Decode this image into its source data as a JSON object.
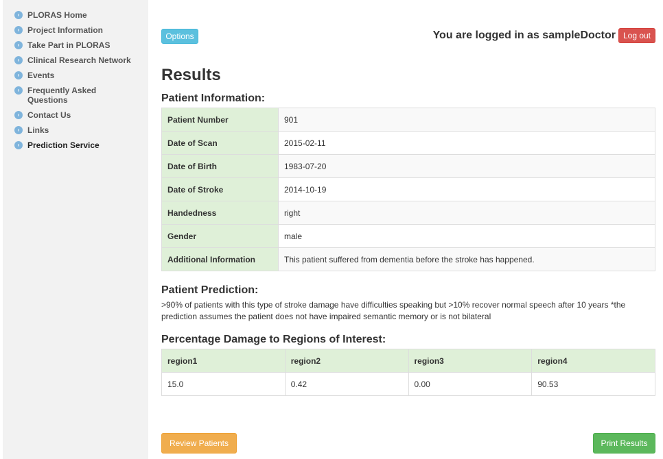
{
  "sidebar": {
    "items": [
      {
        "label": "PLORAS Home",
        "icon": "chevron-right-icon"
      },
      {
        "label": "Project Information",
        "icon": "chevron-right-icon"
      },
      {
        "label": "Take Part in PLORAS",
        "icon": "chevron-right-icon"
      },
      {
        "label": "Clinical Research Network",
        "icon": "chevron-right-icon"
      },
      {
        "label": "Events",
        "icon": "chevron-right-icon"
      },
      {
        "label": "Frequently Asked Questions",
        "icon": "chevron-right-icon"
      },
      {
        "label": "Contact Us",
        "icon": "chevron-right-icon"
      },
      {
        "label": "Links",
        "icon": "chevron-right-icon"
      },
      {
        "label": "Prediction Service",
        "icon": "chevron-right-icon"
      }
    ]
  },
  "header": {
    "options_label": "Options",
    "logged_in_text": "You are logged in as sampleDoctor",
    "logout_label": "Log out"
  },
  "main": {
    "title": "Results",
    "patient_info_heading": "Patient Information:",
    "patient_info": [
      {
        "key": "Patient Number",
        "value": "901"
      },
      {
        "key": "Date of Scan",
        "value": "2015-02-11"
      },
      {
        "key": "Date of Birth",
        "value": "1983-07-20"
      },
      {
        "key": "Date of Stroke",
        "value": "2014-10-19"
      },
      {
        "key": "Handedness",
        "value": "right"
      },
      {
        "key": "Gender",
        "value": "male"
      },
      {
        "key": "Additional Information",
        "value": "This patient suffered from dementia before the stroke has happened."
      }
    ],
    "prediction_heading": "Patient Prediction:",
    "prediction_text": ">90% of patients with this type of stroke damage have difficulties speaking but >10% recover normal speech after 10 years *the prediction assumes the patient does not have impaired semantic memory or is not bilateral",
    "roi_heading": "Percentage Damage to Regions of Interest:",
    "roi_columns": [
      "region1",
      "region2",
      "region3",
      "region4"
    ],
    "roi_values": [
      "15.0",
      "0.42",
      "0.00",
      "90.53"
    ]
  },
  "footer": {
    "review_label": "Review Patients",
    "print_label": "Print Results"
  },
  "colors": {
    "sidebar_bg": "#f2f2f2",
    "table_key_bg": "#dff0d8",
    "options_btn": "#5bc0de",
    "logout_btn": "#d9534f",
    "review_btn": "#f0ad4e",
    "print_btn": "#5cb85c"
  }
}
